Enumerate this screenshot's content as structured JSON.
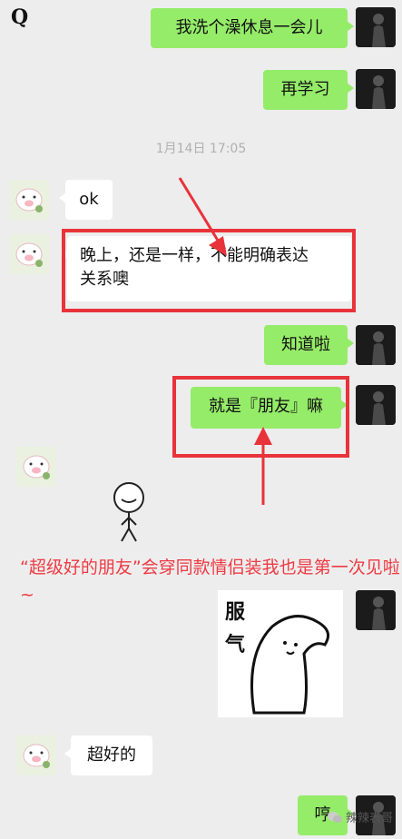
{
  "header": {
    "logo_text": "Q"
  },
  "messages": {
    "m1": "我洗个澡休息一会儿",
    "m2": "再学习",
    "timestamp": "1月14日 17:05",
    "m3": "ok",
    "m4_line1": "晚上，还是一样，不能明确表达",
    "m4_line2": "关系噢",
    "m5": "知道啦",
    "m6": "就是『朋友』嘛",
    "sticker_text_1": "服",
    "sticker_text_2": "气",
    "m8": "超好的",
    "m9": "哼"
  },
  "annotation": {
    "caption": "“超级好的朋友”会穿同款情侣装我也是第一次见啦~"
  },
  "watermark": {
    "text": "辣辣表哥"
  },
  "colors": {
    "green_bubble": "#95ec69",
    "annotation_red": "#e8333a"
  }
}
